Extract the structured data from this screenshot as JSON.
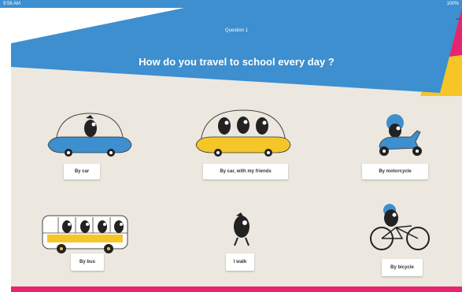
{
  "status_bar": {
    "left": "9:56 AM",
    "right": "100%"
  },
  "header": {
    "label": "Question 1",
    "menu": "•••",
    "question": "How do you travel to school every day ?"
  },
  "options": [
    {
      "label": "By car"
    },
    {
      "label": "By car, with my friends"
    },
    {
      "label": "By motorcycle"
    },
    {
      "label": "By bus"
    },
    {
      "label": "I walk"
    },
    {
      "label": "By bicycle"
    }
  ],
  "colors": {
    "blue": "#3d8fcf",
    "pink": "#e8246f",
    "yellow": "#f6c528",
    "beige": "#ece8df"
  }
}
